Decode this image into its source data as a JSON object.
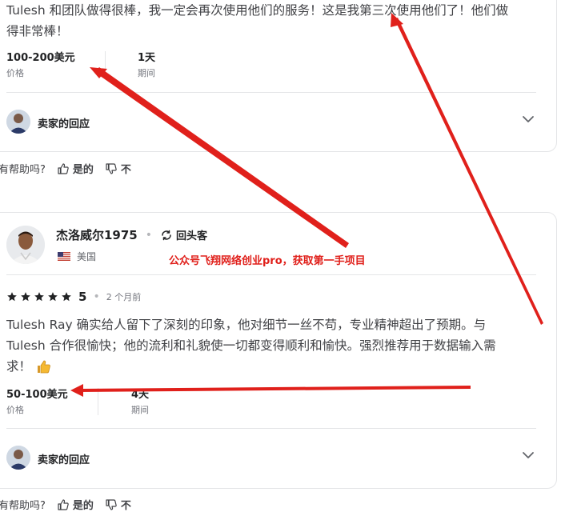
{
  "review1": {
    "text_line1": "Tulesh 和团队做得很棒，我一定会再次使用他们的服务！这是我第三次使用他们了！他们做",
    "text_line2": "得非常棒！",
    "price_value": "100-200美元",
    "price_label": "价格",
    "duration_value": "1天",
    "duration_label": "期间",
    "seller_response_label": "卖家的回应"
  },
  "helpful1": {
    "question": "有帮助吗?",
    "yes_label": "是的",
    "no_label": "不"
  },
  "review2": {
    "reviewer_name": "杰洛威尔1975",
    "repeat_client_label": "回头客",
    "country": "美国",
    "rating": "5",
    "time_ago": "2 个月前",
    "text_line1": "Tulesh Ray 确实给人留下了深刻的印象，他对细节一丝不苟，专业精神超出了预期。与",
    "text_line2": "Tulesh 合作很愉快；他的流利和礼貌使一切都变得顺利和愉快。强烈推荐用于数据输入需",
    "text_line3": "求！",
    "price_value": "50-100美元",
    "price_label": "价格",
    "duration_value": "4天",
    "duration_label": "期间",
    "seller_response_label": "卖家的回应"
  },
  "helpful2": {
    "question": "有帮助吗?",
    "yes_label": "是的",
    "no_label": "不"
  },
  "watermark": "公众号飞翔网络创业pro，获取第一手项目",
  "colors": {
    "annotation_red": "#e0201b",
    "star": "#222325",
    "border": "#e4e5e7",
    "text": "#404145",
    "muted": "#74767e"
  },
  "icons": [
    "chevron-down-icon",
    "thumbs-up-icon",
    "thumbs-down-icon",
    "repeat-icon",
    "us-flag-icon",
    "star-icon",
    "thumbs-up-emoji"
  ]
}
